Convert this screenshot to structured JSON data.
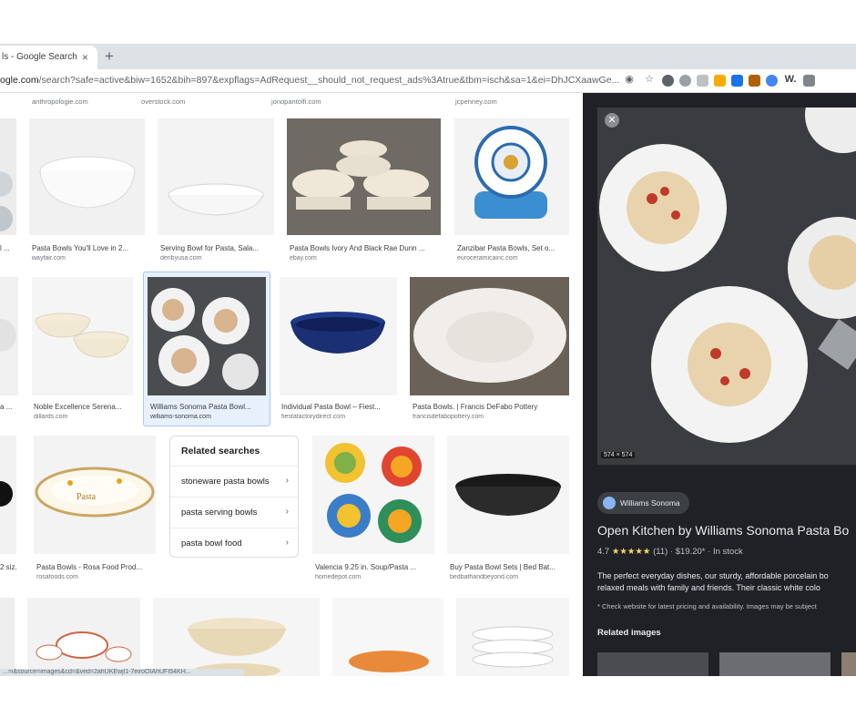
{
  "browser": {
    "tab_title": "ls - Google Search",
    "tab_close": "×",
    "new_tab": "+",
    "url_domain": "ogle.com",
    "url_path": "/search?safe=active&biw=1652&bih=897&expflags=AdRequest__should_not_request_ads%3Atrue&tbm=isch&sa=1&ei=DhJCXaawGe...",
    "icons": [
      "location-icon",
      "star-icon",
      "extension-icons"
    ],
    "ext_label": "W."
  },
  "top_sources": [
    "anthropologie.com",
    "overstock.com",
    "jonopantolfi.com",
    "jcpenney.com"
  ],
  "row1": [
    {
      "caption": "l ...",
      "site": ""
    },
    {
      "caption": "Pasta Bowls You'll Love in 2...",
      "site": "wayfair.com"
    },
    {
      "caption": "Serving Bowl for Pasta, Sala...",
      "site": "denbyusa.com"
    },
    {
      "caption": "Pasta Bowls Ivory And Black Rae Dunn ...",
      "site": "ebay.com"
    },
    {
      "caption": "Zanzibar Pasta Bowls, Set o...",
      "site": "euroceramicainc.com"
    }
  ],
  "row2": [
    {
      "caption": "a ...",
      "site": ""
    },
    {
      "caption": "Noble Excellence Serena...",
      "site": "dillards.com"
    },
    {
      "caption": "Williams Sonoma Pasta Bowl...",
      "site": "williams-sonoma.com"
    },
    {
      "caption": "Individual Pasta Bowl – Fiest...",
      "site": "fiestafactorydirect.com"
    },
    {
      "caption": "Pasta Bowls. | Francis DeFabo Pottery",
      "site": "francisdefabopottery.com"
    }
  ],
  "row3": [
    {
      "caption": "2 siz...",
      "site": ""
    },
    {
      "caption": "Pasta Bowls - Rosa Food Prod...",
      "site": "rosafoods.com"
    },
    {
      "caption": "Valencia 9.25 in. Soup/Pasta ...",
      "site": "homedepot.com"
    },
    {
      "caption": "Buy Pasta Bowl Sets | Bed Bat...",
      "site": "bedbathandbeyond.com"
    }
  ],
  "related_searches": {
    "title": "Related searches",
    "items": [
      "stoneware pasta bowls",
      "pasta serving bowls",
      "pasta bowl food"
    ]
  },
  "status_url": "...=i&source=images&cd=&ved=2ahUKEwjl1-7eiroOIAhUFI54KH...",
  "panel": {
    "close": "✕",
    "dimensions": "574 × 574",
    "source": "Williams Sonoma",
    "title": "Open Kitchen by Williams Sonoma Pasta Bo",
    "rating": "4.7",
    "stars": "★★★★★",
    "reviews": "(11)",
    "price": "$19.20*",
    "stock": "In stock",
    "desc_line1": "The perfect everyday dishes, our sturdy, affordable porcelain bo",
    "desc_line2": "relaxed meals with family and friends. Their classic white colo",
    "disclaimer": "* Check website for latest pricing and availability. Images may be subject",
    "related_images": "Related images"
  },
  "colors": {
    "panel_bg": "#202124",
    "selected_border": "#a8c7fa",
    "star": "#fdd663"
  }
}
